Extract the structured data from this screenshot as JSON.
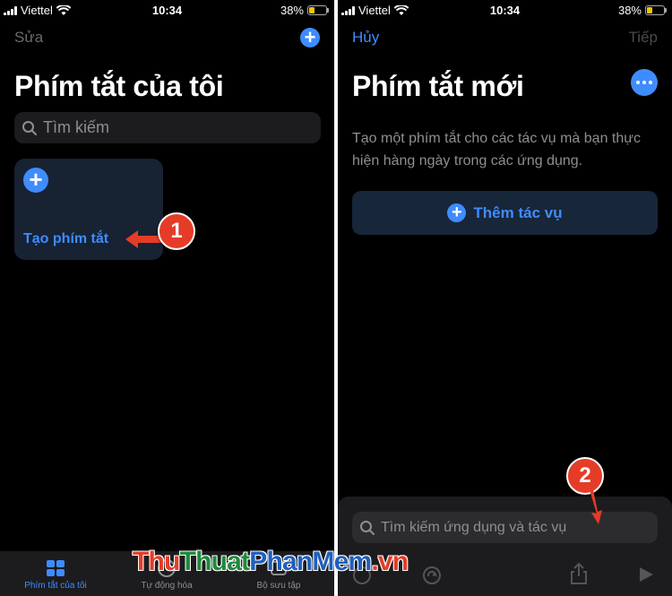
{
  "left": {
    "status": {
      "carrier": "Viettel",
      "time": "10:34",
      "battery": "38%"
    },
    "nav": {
      "edit_label": "Sửa"
    },
    "title": "Phím tắt của tôi",
    "search": {
      "placeholder": "Tìm kiếm"
    },
    "card": {
      "label": "Tạo phím tắt"
    },
    "step": "1",
    "tabs": [
      {
        "label": "Phím tắt của tôi",
        "icon": "grid-icon",
        "active": true
      },
      {
        "label": "Tự động hóa",
        "icon": "clock-icon",
        "active": false
      },
      {
        "label": "Bộ sưu tập",
        "icon": "layers-icon",
        "active": false
      }
    ]
  },
  "right": {
    "status": {
      "carrier": "Viettel",
      "time": "10:34",
      "battery": "38%"
    },
    "nav": {
      "cancel_label": "Hủy",
      "next_label": "Tiếp"
    },
    "title": "Phím tắt mới",
    "description": "Tạo một phím tắt cho các tác vụ mà bạn thực hiện hàng ngày trong các ứng dụng.",
    "add_action_label": "Thêm tác vụ",
    "bottom_search": {
      "placeholder": "Tìm kiếm ứng dụng và tác vụ"
    },
    "step": "2",
    "toolbar_icons": [
      "info-icon",
      "redo-icon",
      "share-icon",
      "play-icon"
    ]
  },
  "watermark": {
    "part1": "Thu",
    "part2": "Thuat",
    "part3": "PhanMem",
    "part4": ".vn"
  },
  "colors": {
    "accent": "#3f8cff",
    "step_badge": "#e53c27",
    "background": "#000000"
  }
}
